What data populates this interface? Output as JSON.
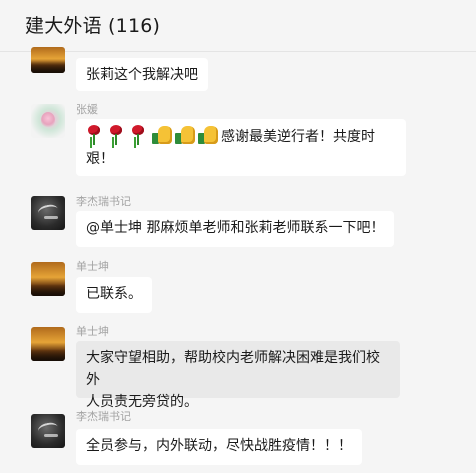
{
  "header": {
    "title": "建大外语 (116)"
  },
  "messages": [
    {
      "avatar": "sunset-photo",
      "name": "",
      "text": "张莉这个我解决吧"
    },
    {
      "avatar": "flower-photo",
      "name": "张媛",
      "text": "感谢最美逆行者！共度时艰！",
      "emoji": [
        "rose-icon",
        "rose-icon",
        "rose-icon",
        "thumbs-up-icon",
        "thumbs-up-icon",
        "thumbs-up-icon"
      ]
    },
    {
      "avatar": "dark-calligraphy",
      "name": "李杰瑞书记",
      "text": "@单士坤 那麻烦单老师和张莉老师联系一下吧！"
    },
    {
      "avatar": "sunset-photo",
      "name": "单士坤",
      "text": "已联系。"
    },
    {
      "avatar": "sunset-photo",
      "name": "单士坤",
      "text_line1": "大家守望相助，帮助校内老师解决困难是我们校外",
      "text_line2": "人员责无旁贷的。"
    },
    {
      "avatar": "dark-calligraphy",
      "name": "李杰瑞书记",
      "text": "全员参与，内外联动，尽快战胜疫情！！！"
    }
  ]
}
